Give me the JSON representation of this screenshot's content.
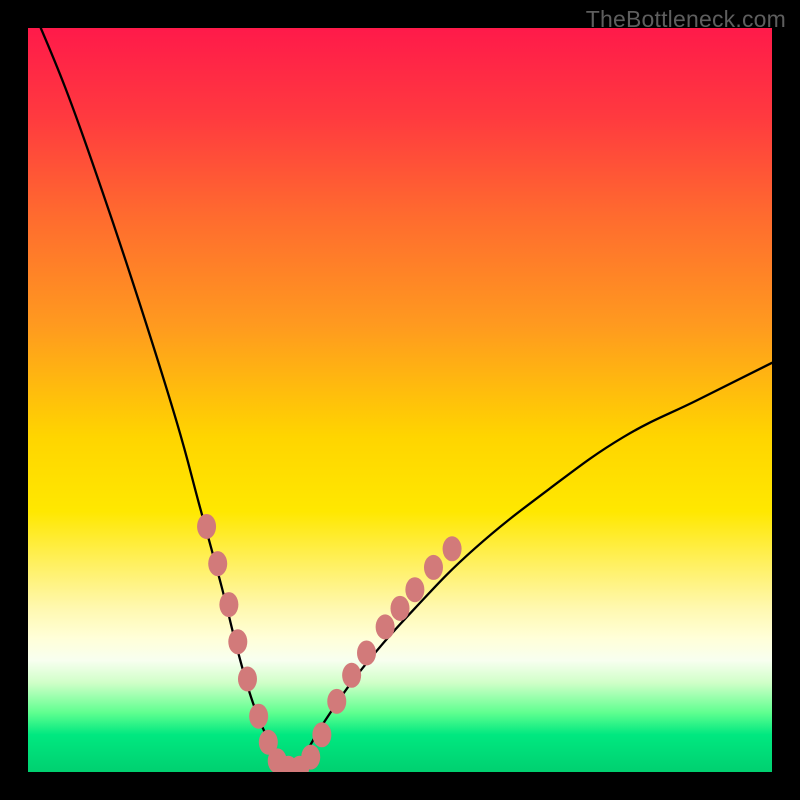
{
  "watermark": "TheBottleneck.com",
  "chart_data": {
    "type": "line",
    "title": "",
    "xlabel": "",
    "ylabel": "",
    "xlim": [
      0,
      100
    ],
    "ylim": [
      0,
      100
    ],
    "series": [
      {
        "name": "bottleneck-curve",
        "x": [
          0,
          5,
          10,
          15,
          20,
          23,
          26,
          28,
          30,
          32,
          34,
          35.5,
          37,
          40,
          45,
          52,
          60,
          70,
          80,
          90,
          100
        ],
        "values": [
          104,
          92,
          78,
          63,
          47,
          36,
          25,
          17,
          10,
          5,
          2,
          0,
          2,
          7,
          14,
          22,
          30,
          38,
          45,
          50,
          55
        ]
      }
    ],
    "markers": {
      "name": "sample-points",
      "color": "#d27a7a",
      "points": [
        {
          "x": 24.0,
          "y": 33.0
        },
        {
          "x": 25.5,
          "y": 28.0
        },
        {
          "x": 27.0,
          "y": 22.5
        },
        {
          "x": 28.2,
          "y": 17.5
        },
        {
          "x": 29.5,
          "y": 12.5
        },
        {
          "x": 31.0,
          "y": 7.5
        },
        {
          "x": 32.3,
          "y": 4.0
        },
        {
          "x": 33.5,
          "y": 1.5
        },
        {
          "x": 35.0,
          "y": 0.5
        },
        {
          "x": 36.5,
          "y": 0.5
        },
        {
          "x": 38.0,
          "y": 2.0
        },
        {
          "x": 39.5,
          "y": 5.0
        },
        {
          "x": 41.5,
          "y": 9.5
        },
        {
          "x": 43.5,
          "y": 13.0
        },
        {
          "x": 45.5,
          "y": 16.0
        },
        {
          "x": 48.0,
          "y": 19.5
        },
        {
          "x": 50.0,
          "y": 22.0
        },
        {
          "x": 52.0,
          "y": 24.5
        },
        {
          "x": 54.5,
          "y": 27.5
        },
        {
          "x": 57.0,
          "y": 30.0
        }
      ]
    }
  }
}
